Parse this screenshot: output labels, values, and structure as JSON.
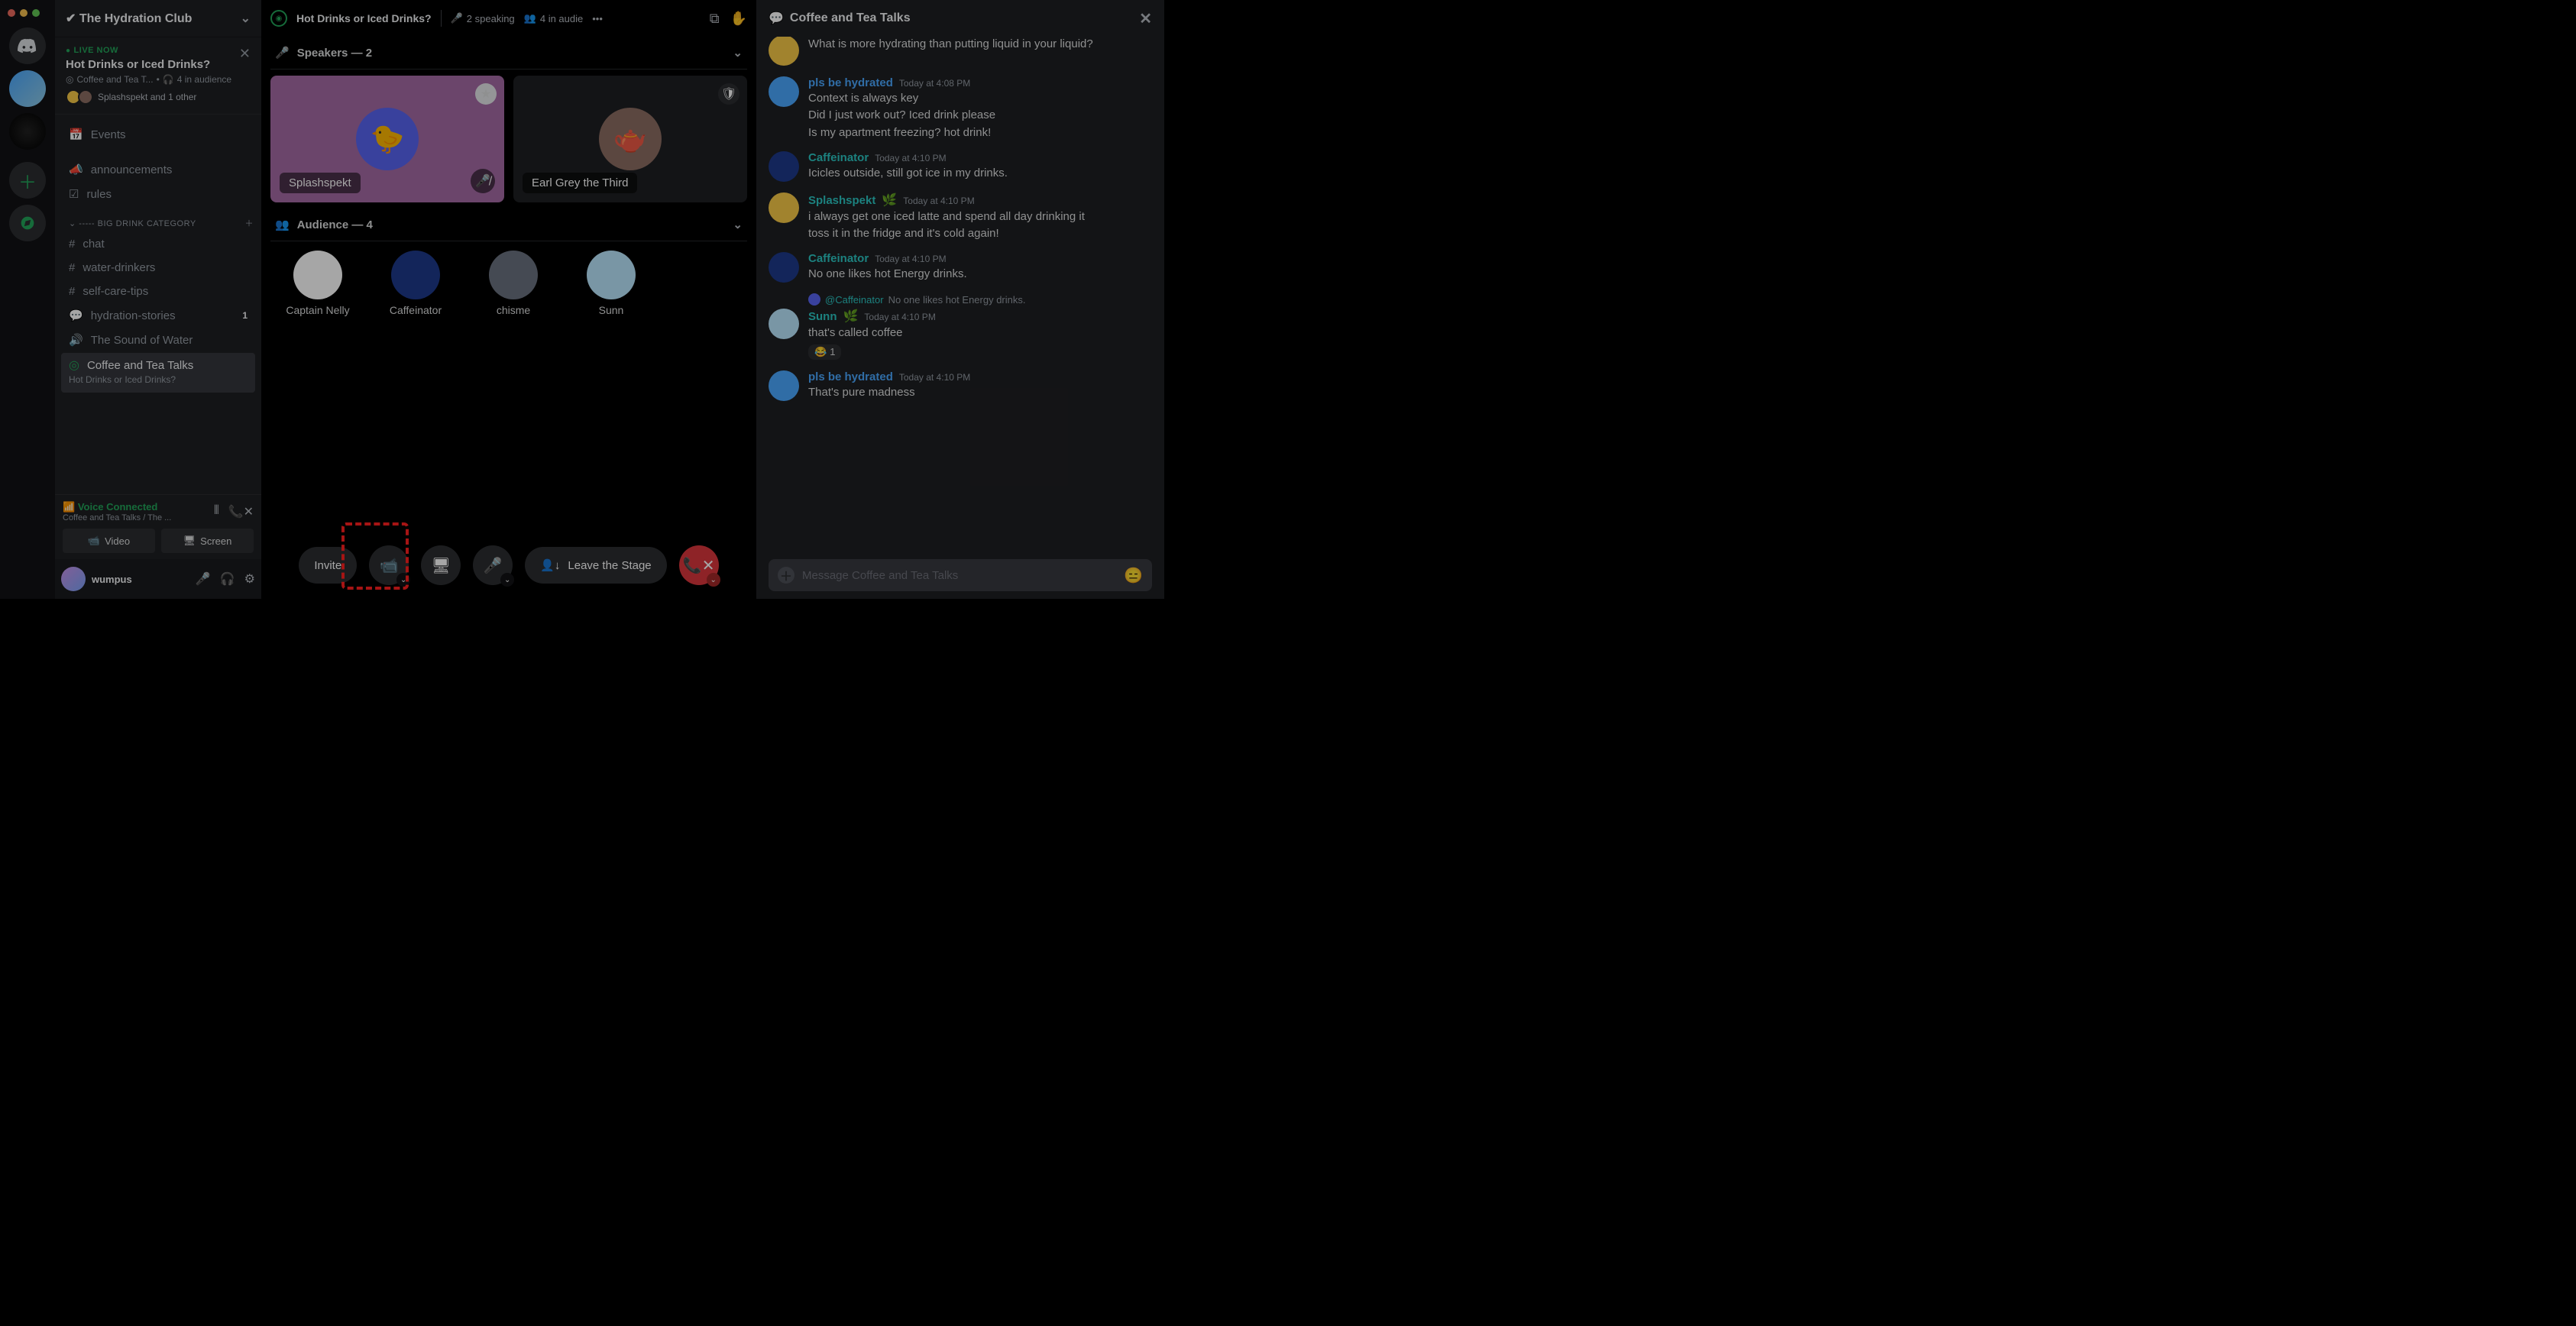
{
  "server": {
    "name": "The Hydration Club"
  },
  "live": {
    "label": "LIVE NOW",
    "title": "Hot Drinks or Iced Drinks?",
    "sub_channel": "Coffee and Tea T...",
    "sub_audience": "4 in audience",
    "presenters": "Splashspekt and 1 other"
  },
  "sidebar": {
    "events": "Events",
    "announcements": "announcements",
    "rules": "rules",
    "category": "----- BIG DRINK CATEGORY",
    "chat": "chat",
    "water": "water-drinkers",
    "selfcare": "self-care-tips",
    "stories": "hydration-stories",
    "stories_unread": "1",
    "sound": "The Sound of Water",
    "stage_name": "Coffee and Tea Talks",
    "stage_topic": "Hot Drinks or Iced Drinks?"
  },
  "voice": {
    "status": "Voice Connected",
    "sub": "Coffee and Tea Talks / The ...",
    "video": "Video",
    "screen": "Screen"
  },
  "user": {
    "name": "wumpus"
  },
  "stage": {
    "title": "Hot Drinks or Iced Drinks?",
    "speaking": "2 speaking",
    "audience_head": "4 in audie",
    "speakers_label": "Speakers — 2",
    "audience_label": "Audience — 4",
    "speaker1": "Splashspekt",
    "speaker2": "Earl Grey the Third",
    "aud1": "Captain Nelly",
    "aud2": "Caffeinator",
    "aud3": "chisme",
    "aud4": "Sunn",
    "invite": "Invite",
    "leave": "Leave the Stage"
  },
  "chat": {
    "title": "Coffee and Tea Talks",
    "placeholder": "Message Coffee and Tea Talks",
    "colors": {
      "hydrated": "#4aa8ff",
      "caff": "#2bc7c3",
      "splash": "#2bc7c3",
      "sunn": "#2bc7c3"
    },
    "m0_body": "What is more hydrating than putting liquid in your liquid?",
    "m1_name": "pls be hydrated",
    "m1_time": "Today at 4:08 PM",
    "m1_b1": "Context is always key",
    "m1_b2": "Did I just work out? Iced drink please",
    "m1_b3": "Is my apartment freezing? hot drink!",
    "m2_name": "Caffeinator",
    "m2_time": "Today at 4:10 PM",
    "m2_b1": "Icicles outside, still got ice in my drinks.",
    "m3_name": "Splashspekt",
    "m3_time": "Today at 4:10 PM",
    "m3_b1": "i always get one iced latte and spend all day drinking it",
    "m3_b2": "toss it in the fridge and it's cold again!",
    "m4_name": "Caffeinator",
    "m4_time": "Today at 4:10 PM",
    "m4_b1": "No one likes hot Energy drinks.",
    "reply_user": "@Caffeinator",
    "reply_text": "No one likes hot Energy drinks.",
    "m5_name": "Sunn",
    "m5_time": "Today at 4:10 PM",
    "m5_b1": "that's called coffee",
    "react_emoji": "😂",
    "react_count": "1",
    "m6_name": "pls be hydrated",
    "m6_time": "Today at 4:10 PM",
    "m6_b1": "That's pure madness"
  }
}
